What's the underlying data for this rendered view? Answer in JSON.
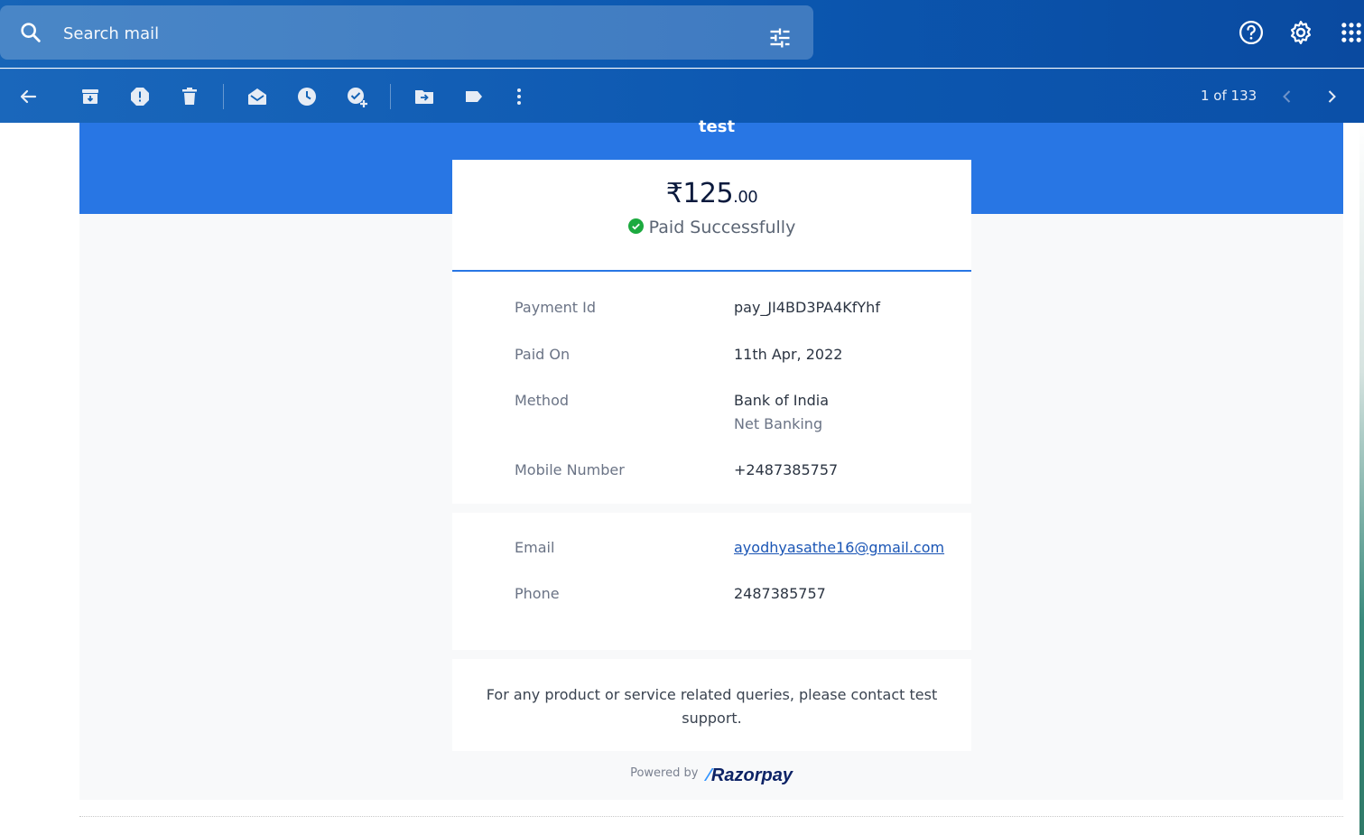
{
  "search": {
    "placeholder": "Search mail"
  },
  "header": {
    "icons": [
      "help-icon",
      "settings-icon",
      "apps-grid-icon"
    ]
  },
  "toolbar": {
    "icons": [
      "back-arrow-icon",
      "archive-icon",
      "report-spam-icon",
      "delete-icon",
      "mark-unread-icon",
      "snooze-icon",
      "add-task-icon",
      "move-to-icon",
      "label-icon",
      "more-vert-icon"
    ],
    "pager_text": "1 of 133"
  },
  "receipt": {
    "merchant": "test",
    "amount_main": "₹125",
    "amount_decimal": ".00",
    "status": "Paid Successfully",
    "details": [
      {
        "label": "Payment Id",
        "value": "pay_JI4BD3PA4KfYhf"
      },
      {
        "label": "Paid On",
        "value": "11th Apr, 2022"
      },
      {
        "label": "Method",
        "value": "Bank of India",
        "sub": "Net Banking"
      },
      {
        "label": "Mobile Number",
        "value": "+2487385757"
      }
    ],
    "contact": [
      {
        "label": "Email",
        "value": "ayodhyasathe16@gmail.com"
      },
      {
        "label": "Phone",
        "value": "2487385757"
      }
    ],
    "support_text": "For any product or service related queries, please contact test support.",
    "powered_by": "Powered by",
    "brand": "Razorpay"
  },
  "colors": {
    "header_bg": "#0b57b0",
    "banner_blue": "#2876e4",
    "success_green": "#1caa3f",
    "link_blue": "#1a55b5"
  }
}
